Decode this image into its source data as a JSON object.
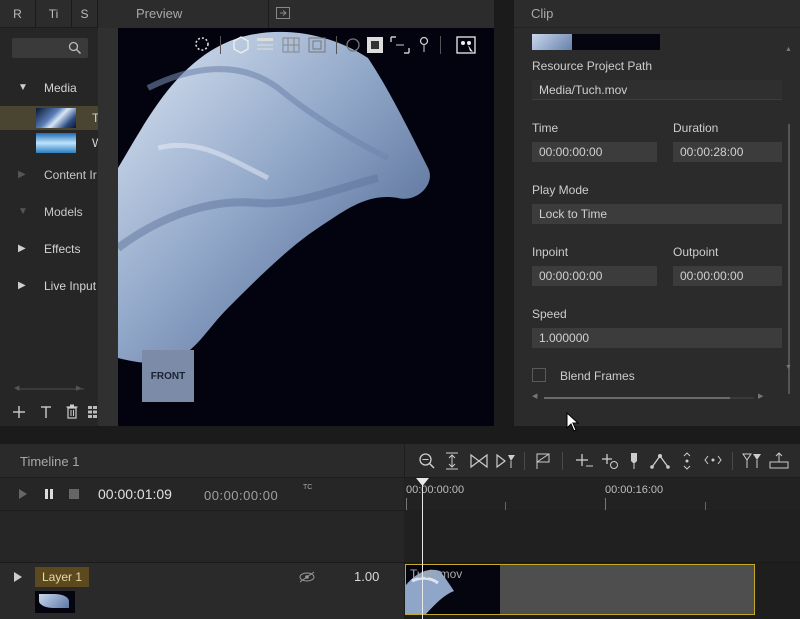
{
  "left_panel": {
    "tabs": [
      "R",
      "Ti",
      "S"
    ],
    "tree": [
      {
        "label": "Media",
        "expanded": true
      },
      {
        "label": "T",
        "child": true
      },
      {
        "label": "W",
        "child": true
      },
      {
        "label": "Content Ir",
        "expanded": false,
        "dim": true
      },
      {
        "label": "Models",
        "expanded": true,
        "dim": true
      },
      {
        "label": "Effects",
        "expanded": false
      },
      {
        "label": "Live Input",
        "expanded": false
      }
    ]
  },
  "preview": {
    "title": "Preview",
    "front_label": "FRONT"
  },
  "clip_panel": {
    "title": "Clip",
    "resource_path_label": "Resource Project Path",
    "resource_path_value": "Media/Tuch.mov",
    "time_label": "Time",
    "time_value": "00:00:00:00",
    "duration_label": "Duration",
    "duration_value": "00:00:28:00",
    "play_mode_label": "Play Mode",
    "play_mode_value": "Lock to Time",
    "inpoint_label": "Inpoint",
    "inpoint_value": "00:00:00:00",
    "outpoint_label": "Outpoint",
    "outpoint_value": "00:00:00:00",
    "speed_label": "Speed",
    "speed_value": "1.000000",
    "blend_frames_label": "Blend Frames",
    "blend_frames_checked": false
  },
  "timeline": {
    "title": "Timeline 1",
    "current_time": "00:00:01:09",
    "secondary_time": "00:00:00:00",
    "tc_label": "TC",
    "ruler_marks": [
      "00:00:00:00",
      "00:00:16:00"
    ],
    "layer_name": "Layer 1",
    "layer_opacity": "1.00",
    "clip_name": "Tuch.mov"
  },
  "colors": {
    "accent_gold": "#c4a82a",
    "layer_label_bg": "#5c4a1e"
  }
}
